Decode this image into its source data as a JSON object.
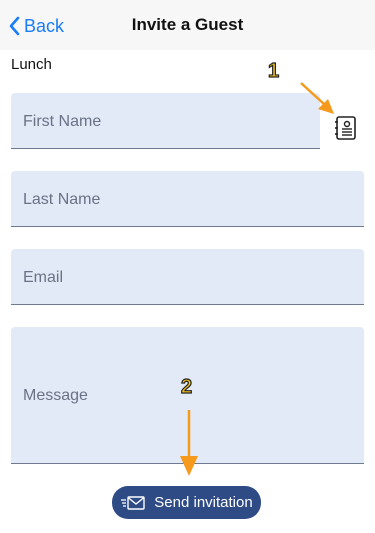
{
  "nav": {
    "back_label": "Back",
    "title": "Invite a Guest"
  },
  "section_label": "Lunch",
  "fields": {
    "first_name_placeholder": "First Name",
    "last_name_placeholder": "Last Name",
    "email_placeholder": "Email",
    "message_placeholder": "Message"
  },
  "send_button": {
    "label": "Send invitation",
    "icon": "send-envelope-icon"
  },
  "annotations": {
    "step1": "1",
    "step2": "2"
  },
  "colors": {
    "accent": "#1a7cf6",
    "button": "#2e4b86",
    "field_bg": "#e2e9f7",
    "arrow": "#f59a1c"
  },
  "icons": {
    "back": "chevron-left-icon",
    "contacts": "contact-card-icon"
  }
}
